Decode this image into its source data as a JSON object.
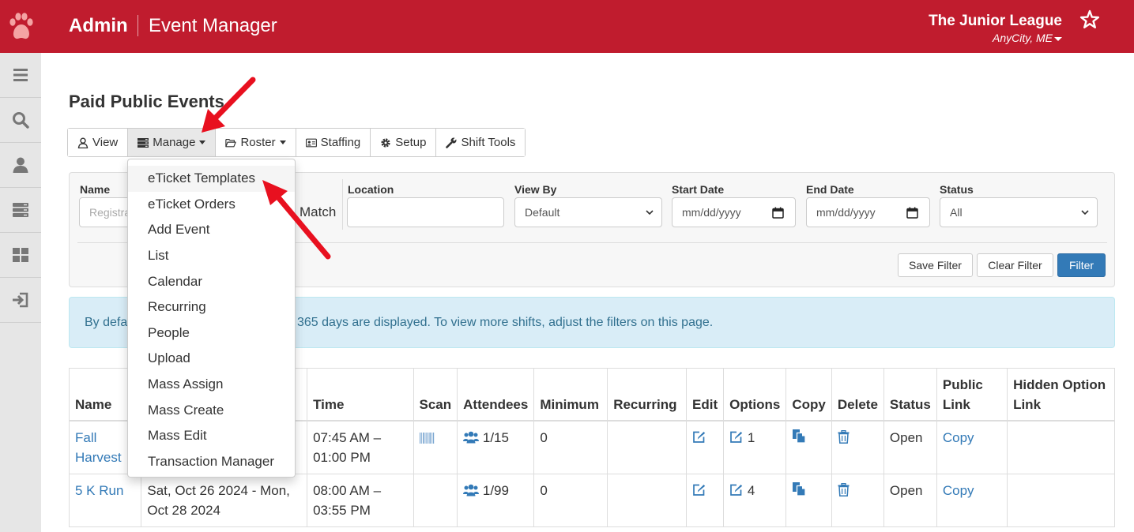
{
  "header": {
    "brand": "Admin",
    "app_title": "Event Manager",
    "org_name": "The Junior League",
    "org_location": "AnyCity, ME"
  },
  "sidebar": {
    "items": [
      {
        "icon": "menu-icon"
      },
      {
        "icon": "search-icon"
      },
      {
        "icon": "user-icon"
      },
      {
        "icon": "server-icon"
      },
      {
        "icon": "dashboard-icon"
      },
      {
        "icon": "logout-icon"
      }
    ]
  },
  "page_title": "Paid Public Events",
  "tabs": {
    "view": "View",
    "manage": "Manage",
    "roster": "Roster",
    "staffing": "Staffing",
    "setup": "Setup",
    "shift_tools": "Shift Tools"
  },
  "manage_menu": {
    "items": [
      "eTicket Templates",
      "eTicket Orders",
      "Add Event",
      "List",
      "Calendar",
      "Recurring",
      "People",
      "Upload",
      "Mass Assign",
      "Mass Create",
      "Mass Edit",
      "Transaction Manager"
    ]
  },
  "filters": {
    "name_label": "Name",
    "name_placeholder": "Registra",
    "match_label": "Match",
    "location_label": "Location",
    "location_value": "",
    "view_by_label": "View By",
    "view_by_value": "Default",
    "start_date_label": "Start Date",
    "start_date_placeholder": "mm/dd/yyyy",
    "end_date_label": "End Date",
    "end_date_placeholder": "mm/dd/yyyy",
    "status_label": "Status",
    "status_value": "All",
    "save_filter": "Save Filter",
    "clear_filter": "Clear Filter",
    "filter": "Filter"
  },
  "info": {
    "text_left": "By defa",
    "text_right": "365 days are displayed. To view more shifts, adjust the filters on this page."
  },
  "table": {
    "headers": {
      "name": "Name",
      "date": "",
      "time": "Time",
      "scan": "Scan",
      "attendees": "Attendees",
      "minimum": "Minimum",
      "recurring": "Recurring",
      "edit": "Edit",
      "options": "Options",
      "copy": "Copy",
      "delete": "Delete",
      "status": "Status",
      "public_link": "Public Link",
      "hidden_option_link": "Hidden Option Link"
    },
    "rows": [
      {
        "name": "Fall Harvest",
        "date": "",
        "time": "07:45 AM – 01:00 PM",
        "attendees": "1/15",
        "minimum": "0",
        "recurring": "",
        "options_count": "1",
        "status": "Open",
        "public_link": "Copy",
        "hidden_link": ""
      },
      {
        "name": "5 K Run",
        "date": "Sat, Oct 26 2024 - Mon, Oct 28 2024",
        "time": "08:00 AM – 03:55 PM",
        "attendees": "1/99",
        "minimum": "0",
        "recurring": "",
        "options_count": "4",
        "status": "Open",
        "public_link": "Copy",
        "hidden_link": ""
      }
    ]
  },
  "colors": {
    "header_bg": "#c01c2e",
    "link": "#337ab7",
    "primary_button": "#337ab7",
    "annotation_arrow": "#e8101f"
  }
}
